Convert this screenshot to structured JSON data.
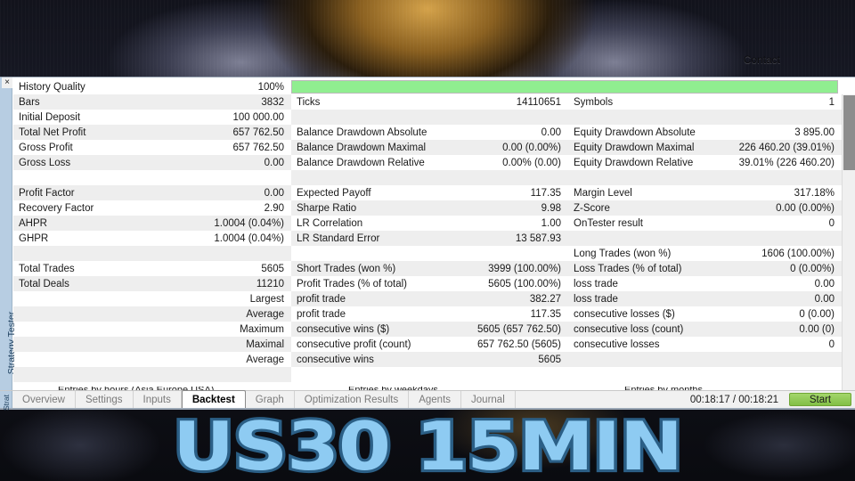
{
  "hero": {
    "contact_label": "Contact",
    "bottom_title": "US30 15MIN",
    "title_color": "#8ecbf2",
    "title_outline_color": "#2b5f86"
  },
  "panel": {
    "rail_label": "Strategy Tester",
    "close_icon": "×",
    "progress": {
      "percent": 100,
      "fill_color": "#90ee90"
    }
  },
  "columns": [
    {
      "name": "left",
      "rows": [
        {
          "label": "History Quality",
          "value": "100%"
        },
        {
          "label": "Bars",
          "value": "3832"
        },
        {
          "label": "Initial Deposit",
          "value": "100 000.00"
        },
        {
          "label": "Total Net Profit",
          "value": "657 762.50"
        },
        {
          "label": "Gross Profit",
          "value": "657 762.50"
        },
        {
          "label": "Gross Loss",
          "value": "0.00"
        },
        {
          "label": "",
          "value": ""
        },
        {
          "label": "Profit Factor",
          "value": "0.00"
        },
        {
          "label": "Recovery Factor",
          "value": "2.90"
        },
        {
          "label": "AHPR",
          "value": "1.0004 (0.04%)"
        },
        {
          "label": "GHPR",
          "value": "1.0004 (0.04%)"
        },
        {
          "label": "",
          "value": ""
        },
        {
          "label": "Total Trades",
          "value": "5605"
        },
        {
          "label": "Total Deals",
          "value": "11210"
        },
        {
          "label": "",
          "value": "Largest"
        },
        {
          "label": "",
          "value": "Average"
        },
        {
          "label": "",
          "value": "Maximum"
        },
        {
          "label": "",
          "value": "Maximal"
        },
        {
          "label": "",
          "value": "Average"
        },
        {
          "label": "",
          "value": ""
        }
      ]
    },
    {
      "name": "middle",
      "rows": [
        {
          "label": "Ticks",
          "value": "14110651"
        },
        {
          "label": "",
          "value": ""
        },
        {
          "label": "Balance Drawdown Absolute",
          "value": "0.00"
        },
        {
          "label": "Balance Drawdown Maximal",
          "value": "0.00 (0.00%)"
        },
        {
          "label": "Balance Drawdown Relative",
          "value": "0.00% (0.00)"
        },
        {
          "label": "",
          "value": ""
        },
        {
          "label": "Expected Payoff",
          "value": "117.35"
        },
        {
          "label": "Sharpe Ratio",
          "value": "9.98"
        },
        {
          "label": "LR Correlation",
          "value": "1.00"
        },
        {
          "label": "LR Standard Error",
          "value": "13 587.93"
        },
        {
          "label": "",
          "value": ""
        },
        {
          "label": "Short Trades (won %)",
          "value": "3999 (100.00%)"
        },
        {
          "label": "Profit Trades (% of total)",
          "value": "5605 (100.00%)"
        },
        {
          "label": "profit trade",
          "value": "382.27"
        },
        {
          "label": "profit trade",
          "value": "117.35"
        },
        {
          "label": "consecutive wins ($)",
          "value": "5605 (657 762.50)"
        },
        {
          "label": "consecutive profit (count)",
          "value": "657 762.50 (5605)"
        },
        {
          "label": "consecutive wins",
          "value": "5605"
        },
        {
          "label": "",
          "value": ""
        }
      ]
    },
    {
      "name": "right",
      "rows": [
        {
          "label": "Symbols",
          "value": "1"
        },
        {
          "label": "",
          "value": ""
        },
        {
          "label": "Equity Drawdown Absolute",
          "value": "3 895.00"
        },
        {
          "label": "Equity Drawdown Maximal",
          "value": "226 460.20 (39.01%)"
        },
        {
          "label": "Equity Drawdown Relative",
          "value": "39.01% (226 460.20)"
        },
        {
          "label": "",
          "value": ""
        },
        {
          "label": "Margin Level",
          "value": "317.18%"
        },
        {
          "label": "Z-Score",
          "value": "0.00 (0.00%)"
        },
        {
          "label": "OnTester result",
          "value": "0"
        },
        {
          "label": "",
          "value": ""
        },
        {
          "label": "Long Trades (won %)",
          "value": "1606 (100.00%)"
        },
        {
          "label": "Loss Trades (% of total)",
          "value": "0 (0.00%)"
        },
        {
          "label": "loss trade",
          "value": "0.00"
        },
        {
          "label": "loss trade",
          "value": "0.00"
        },
        {
          "label": "consecutive losses ($)",
          "value": "0 (0.00)"
        },
        {
          "label": "consecutive loss (count)",
          "value": "0.00 (0)"
        },
        {
          "label": "consecutive losses",
          "value": "0"
        },
        {
          "label": "",
          "value": ""
        }
      ]
    }
  ],
  "charts": [
    {
      "title": "Entries by hours (Asia Europe USA)"
    },
    {
      "title": "Entries by weekdays"
    },
    {
      "title": "Entries by months"
    }
  ],
  "tabbar": {
    "rail_label": "Strat",
    "tabs": [
      {
        "label": "Overview",
        "active": false
      },
      {
        "label": "Settings",
        "active": false
      },
      {
        "label": "Inputs",
        "active": false
      },
      {
        "label": "Backtest",
        "active": true
      },
      {
        "label": "Graph",
        "active": false
      },
      {
        "label": "Optimization Results",
        "active": false
      },
      {
        "label": "Agents",
        "active": false
      },
      {
        "label": "Journal",
        "active": false
      }
    ],
    "timing": "00:18:17 / 00:18:21",
    "start_label": "Start",
    "start_color": "#8bc34a"
  }
}
